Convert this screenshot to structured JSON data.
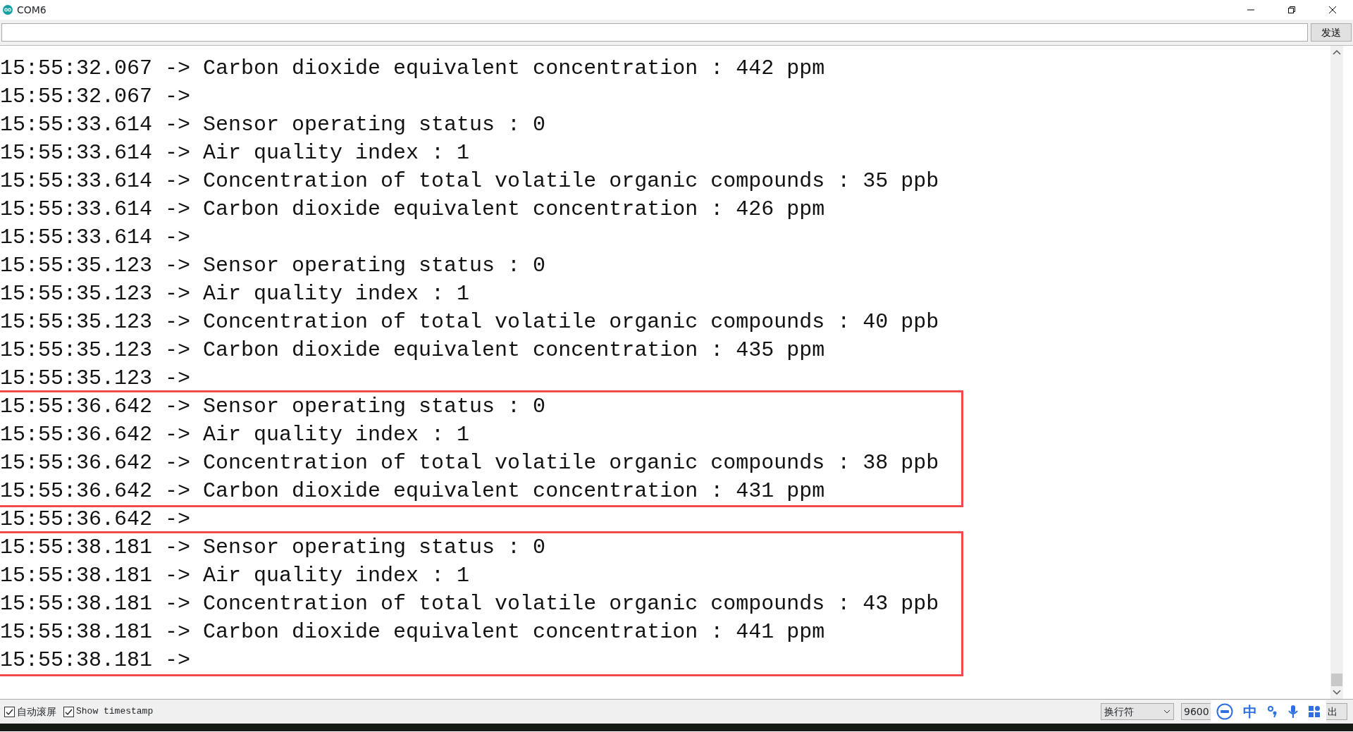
{
  "window": {
    "title": "COM6"
  },
  "send": {
    "button": "发送"
  },
  "log": [
    {
      "kind": "line",
      "text": "15:55:32.067 -> Carbon dioxide equivalent concentration : 442 ppm"
    },
    {
      "kind": "line",
      "text": "15:55:32.067 -> "
    },
    {
      "kind": "line",
      "text": "15:55:33.614 -> Sensor operating status : 0"
    },
    {
      "kind": "line",
      "text": "15:55:33.614 -> Air quality index : 1"
    },
    {
      "kind": "line",
      "text": "15:55:33.614 -> Concentration of total volatile organic compounds : 35 ppb"
    },
    {
      "kind": "line",
      "text": "15:55:33.614 -> Carbon dioxide equivalent concentration : 426 ppm"
    },
    {
      "kind": "line",
      "text": "15:55:33.614 -> "
    },
    {
      "kind": "line",
      "text": "15:55:35.123 -> Sensor operating status : 0"
    },
    {
      "kind": "line",
      "text": "15:55:35.123 -> Air quality index : 1"
    },
    {
      "kind": "line",
      "text": "15:55:35.123 -> Concentration of total volatile organic compounds : 40 ppb"
    },
    {
      "kind": "line",
      "text": "15:55:35.123 -> Carbon dioxide equivalent concentration : 435 ppm"
    },
    {
      "kind": "line",
      "text": "15:55:35.123 -> "
    },
    {
      "kind": "marked_group",
      "color": "#f04a4a",
      "lines": [
        "15:55:36.642 -> Sensor operating status : 0",
        "15:55:36.642 -> Air quality index : 1",
        "15:55:36.642 -> Concentration of total volatile organic compounds : 38 ppb",
        "15:55:36.642 -> Carbon dioxide equivalent concentration : 431 ppm"
      ]
    },
    {
      "kind": "line",
      "text": "15:55:36.642 -> "
    },
    {
      "kind": "marked_group",
      "color": "#f04a4a",
      "lines": [
        "15:55:38.181 -> Sensor operating status : 0",
        "15:55:38.181 -> Air quality index : 1",
        "15:55:38.181 -> Concentration of total volatile organic compounds : 43 ppb",
        "15:55:38.181 -> Carbon dioxide equivalent concentration : 441 ppm",
        "15:55:38.181 -> "
      ]
    }
  ],
  "footer": {
    "checkboxes": [
      {
        "label": "自动滚屏",
        "checked": true
      },
      {
        "label": "Show timestamp",
        "checked": true
      }
    ],
    "line_ending": "换行符",
    "baud": "9600",
    "ime_label": "中",
    "clear_partial": "出"
  }
}
